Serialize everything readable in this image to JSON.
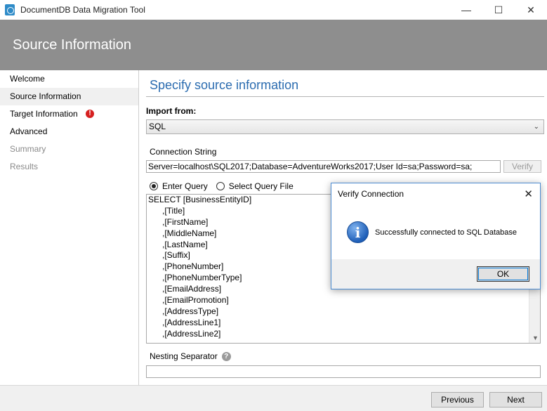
{
  "window": {
    "title": "DocumentDB Data Migration Tool",
    "minimize": "—",
    "maximize": "☐",
    "close": "✕"
  },
  "header": {
    "title": "Source Information"
  },
  "sidebar": {
    "items": [
      {
        "label": "Welcome"
      },
      {
        "label": "Source Information"
      },
      {
        "label": "Target Information"
      },
      {
        "label": "Advanced"
      },
      {
        "label": "Summary"
      },
      {
        "label": "Results"
      }
    ],
    "error_icon": "!"
  },
  "main": {
    "title": "Specify source information",
    "import_from_label": "Import from:",
    "import_from_value": "SQL",
    "connection_string_label": "Connection String",
    "connection_string_value": "Server=localhost\\SQL2017;Database=AdventureWorks2017;User Id=sa;Password=sa;",
    "verify_label": "Verify",
    "radio_enter_query": "Enter Query",
    "radio_select_file": "Select Query File",
    "query_lines": [
      "SELECT [BusinessEntityID]",
      "      ,[Title]",
      "      ,[FirstName]",
      "      ,[MiddleName]",
      "      ,[LastName]",
      "      ,[Suffix]",
      "      ,[PhoneNumber]",
      "      ,[PhoneNumberType]",
      "      ,[EmailAddress]",
      "      ,[EmailPromotion]",
      "      ,[AddressType]",
      "      ,[AddressLine1]",
      "      ,[AddressLine2]"
    ],
    "nesting_separator_label": "Nesting Separator",
    "help_icon": "?"
  },
  "footer": {
    "previous_label": "Previous",
    "next_label": "Next"
  },
  "modal": {
    "title": "Verify Connection",
    "close": "✕",
    "icon": "i",
    "message": "Successfully connected to SQL Database",
    "ok_label": "OK"
  }
}
